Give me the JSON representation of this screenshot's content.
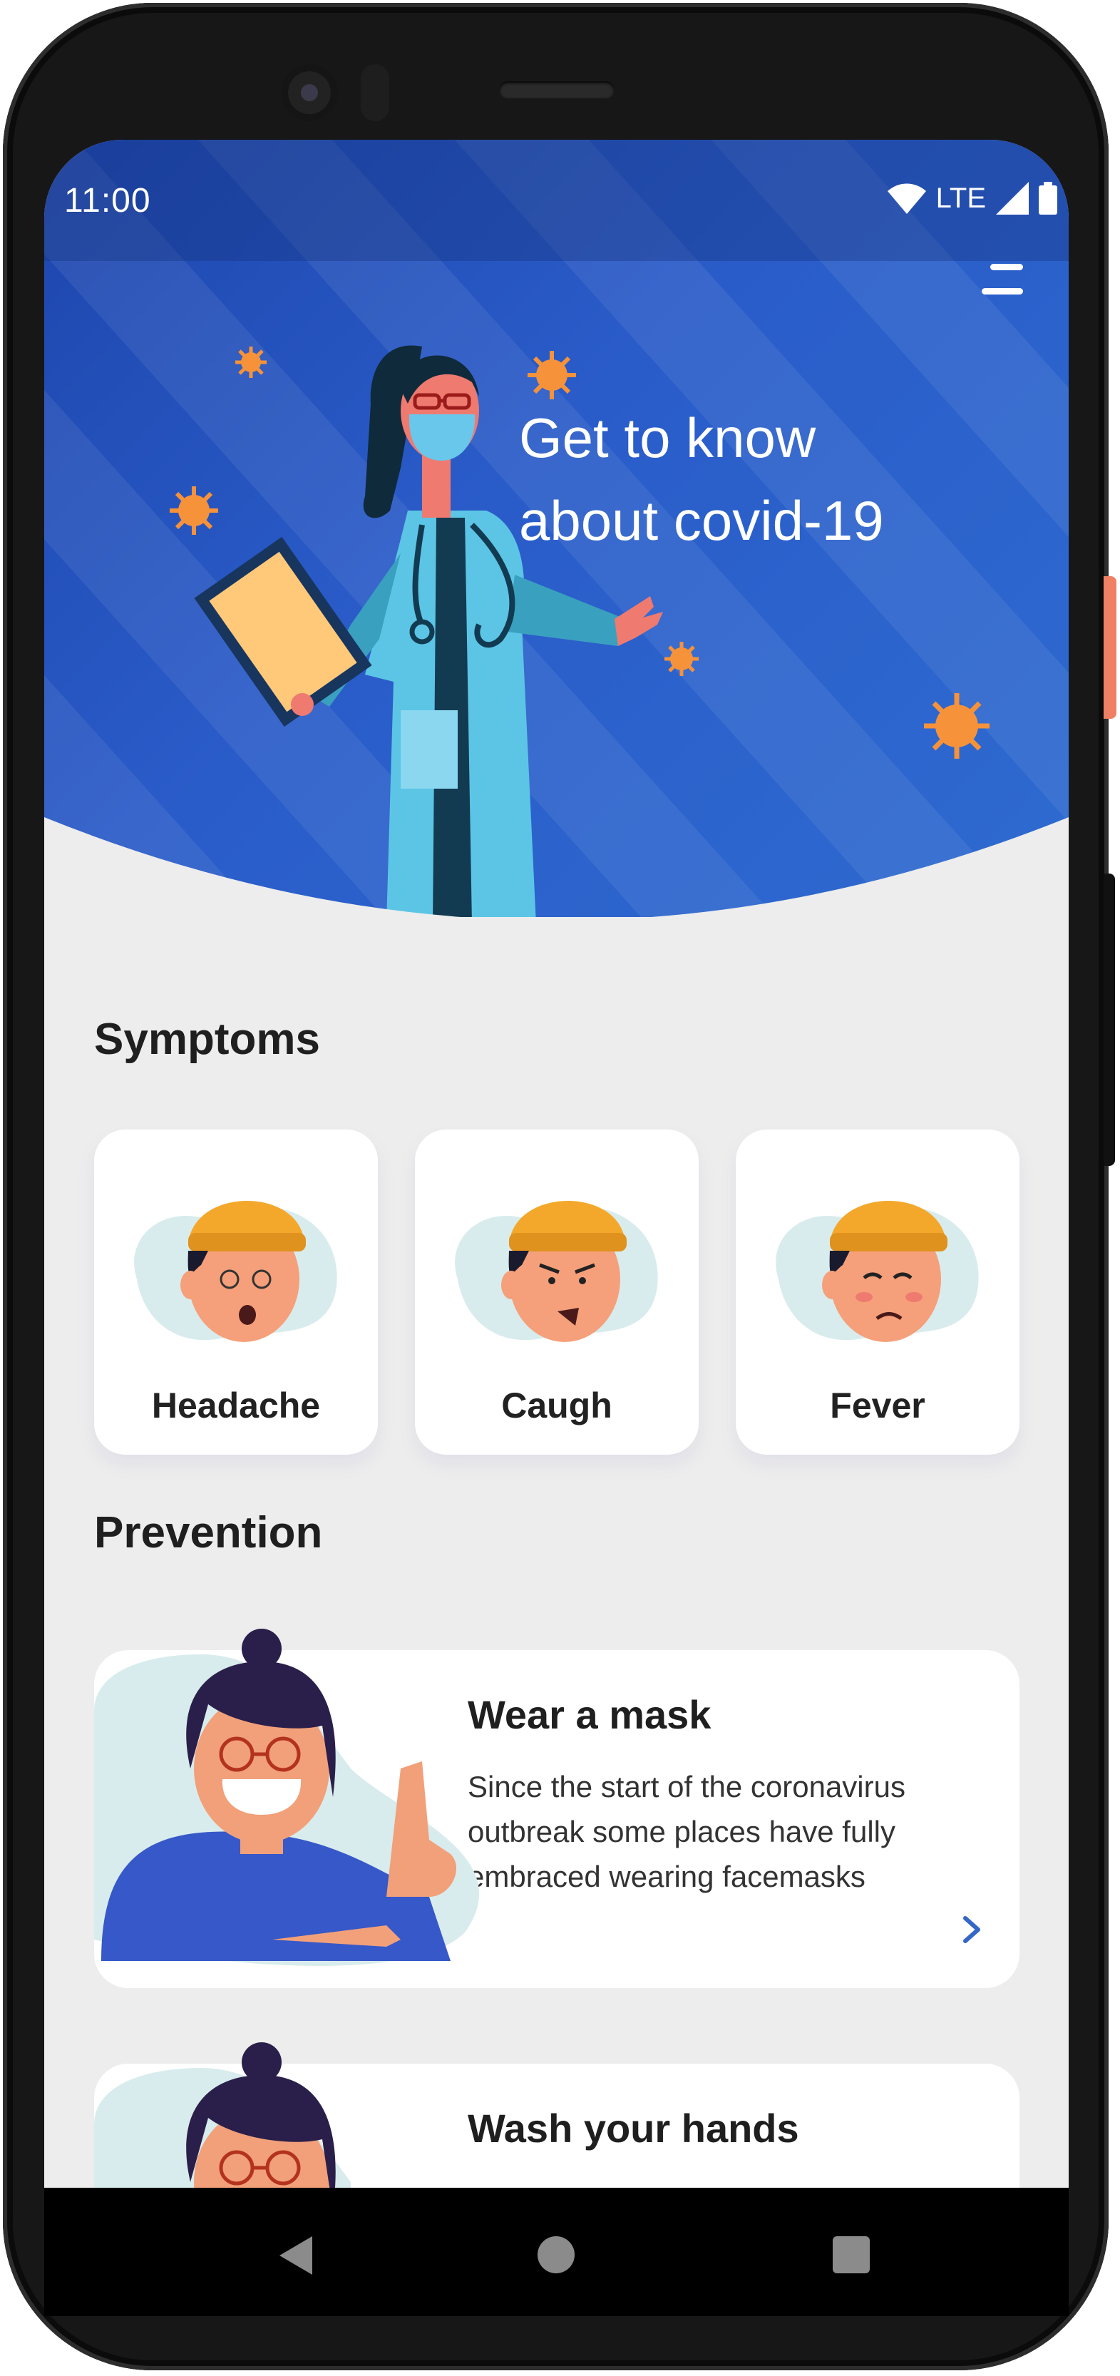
{
  "status_bar": {
    "time": "11:00",
    "network": "LTE"
  },
  "hero": {
    "title_line1": "Get to know",
    "title_line2": "about covid-19"
  },
  "symptoms": {
    "title": "Symptoms",
    "items": [
      {
        "label": "Headache",
        "icon": "dizzy-face-icon"
      },
      {
        "label": "Caugh",
        "icon": "coughing-face-icon"
      },
      {
        "label": "Fever",
        "icon": "feverish-face-icon"
      }
    ]
  },
  "prevention": {
    "title": "Prevention",
    "items": [
      {
        "title": "Wear a mask",
        "description": "Since the start of the coronavirus outbreak some places have fully embraced wearing facemasks"
      },
      {
        "title": "Wash your hands"
      }
    ]
  },
  "colors": {
    "hero_blue": "#2a5cc9",
    "background": "#ededed",
    "accent_orange": "#f6923a",
    "arrow_blue": "#3567c7"
  }
}
